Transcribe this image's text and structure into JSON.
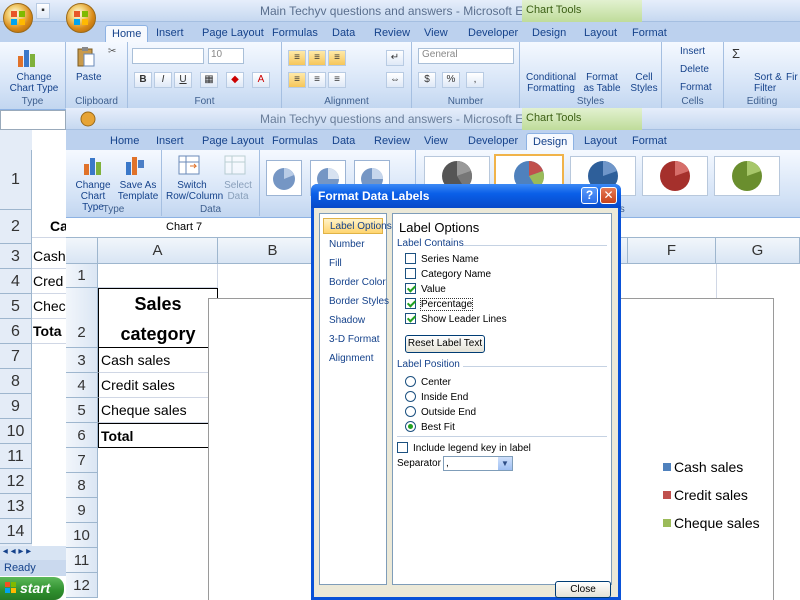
{
  "back_window": {
    "title": "Main Techyv questions and answers - Microsoft Excel",
    "contextual_tab_group": "Chart Tools",
    "tabs": [
      "Home",
      "Insert",
      "Page Layout",
      "Formulas",
      "Data",
      "Review",
      "View",
      "Developer",
      "Design",
      "Layout",
      "Format"
    ],
    "groups": [
      "Type",
      "Clipboard",
      "Font",
      "Alignment",
      "Number",
      "Styles",
      "Cells",
      "Editing"
    ],
    "buttons": {
      "change_chart_type": "Change Chart Type",
      "paste": "Paste",
      "conditional_formatting": "Conditional Formatting",
      "format_as_table": "Format as Table",
      "cell_styles": "Cell Styles",
      "insert": "Insert",
      "delete": "Delete",
      "format": "Format",
      "sort_filter": "Sort & Filter",
      "find": "Fir",
      "number_format": "General",
      "font_size": "10"
    },
    "row_numbers": [
      "1",
      "2",
      "3",
      "4",
      "5",
      "6",
      "7",
      "8",
      "9",
      "10",
      "11",
      "12",
      "13",
      "14"
    ],
    "cells": [
      "Ca",
      "Cash",
      "Cred",
      "Chec",
      "Tota"
    ]
  },
  "front_window": {
    "title": "Main Techyv questions and answers - Microsoft Excel",
    "contextual_tab_group": "Chart Tools",
    "tabs": [
      "Home",
      "Insert",
      "Page Layout",
      "Formulas",
      "Data",
      "Review",
      "View",
      "Developer",
      "Design",
      "Layout",
      "Format"
    ],
    "active_tab": "Design",
    "buttons": {
      "change_chart_type": "Change Chart Type",
      "save_as_template": "Save As Template",
      "switch_row_column": "Switch Row/Column",
      "select_data": "Select Data"
    },
    "groups": {
      "type": "Type",
      "data": "Data",
      "chart_styles_partial": "les"
    },
    "name_box": "Chart 7",
    "columns": [
      "A",
      "B",
      "F",
      "G"
    ],
    "rows": [
      "1",
      "2",
      "3",
      "4",
      "5",
      "6",
      "7",
      "8",
      "9",
      "10",
      "11",
      "12"
    ],
    "cells": {
      "header": "Sales category",
      "r3": "Cash sales",
      "r4": "Credit sales",
      "r5": "Cheque sales",
      "r6": "Total"
    },
    "legend": [
      {
        "label": "Cash sales",
        "color": "#4f81bd"
      },
      {
        "label": "Credit sales",
        "color": "#c0504d"
      },
      {
        "label": "Cheque sales",
        "color": "#9bbb59"
      }
    ]
  },
  "status_bar": {
    "ready": "Ready",
    "start": "start"
  },
  "dialog": {
    "title": "Format Data Labels",
    "help_icon": "?",
    "close_icon": "✕",
    "nav": [
      "Label Options",
      "Number",
      "Fill",
      "Border Color",
      "Border Styles",
      "Shadow",
      "3-D Format",
      "Alignment"
    ],
    "active_nav": "Label Options",
    "panel_title": "Label Options",
    "label_contains": {
      "heading": "Label Contains",
      "items": [
        {
          "label": "Series Name",
          "checked": false
        },
        {
          "label": "Category Name",
          "checked": false
        },
        {
          "label": "Value",
          "checked": true
        },
        {
          "label": "Percentage",
          "checked": true
        },
        {
          "label": "Show Leader Lines",
          "checked": true
        }
      ]
    },
    "reset_button": "Reset Label Text",
    "label_position": {
      "heading": "Label Position",
      "items": [
        {
          "label": "Center",
          "selected": false
        },
        {
          "label": "Inside End",
          "selected": false
        },
        {
          "label": "Outside End",
          "selected": false
        },
        {
          "label": "Best Fit",
          "selected": true
        }
      ]
    },
    "include_legend_key": {
      "label": "Include legend key in label",
      "checked": false
    },
    "separator": {
      "label": "Separator",
      "value": ","
    },
    "close_button": "Close"
  }
}
